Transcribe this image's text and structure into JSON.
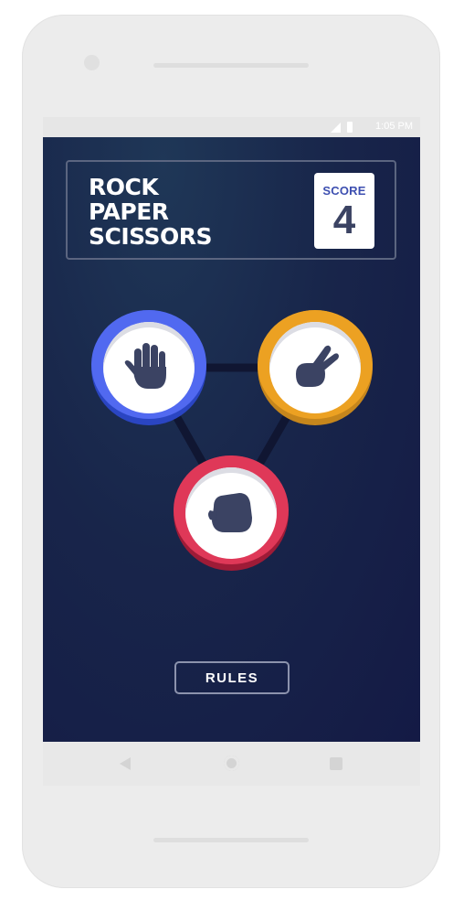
{
  "status_bar": {
    "time": "1:05 PM"
  },
  "header": {
    "title_lines": [
      "ROCK",
      "PAPER",
      "SCISSORS"
    ],
    "score_label": "SCORE",
    "score_value": "4"
  },
  "choices": [
    {
      "name": "paper",
      "icon": "hand-open-icon",
      "color": "#5169f0"
    },
    {
      "name": "scissors",
      "icon": "hand-scissors-icon",
      "color": "#eca122"
    },
    {
      "name": "rock",
      "icon": "hand-fist-icon",
      "color": "#df3858"
    }
  ],
  "rules_button": {
    "label": "RULES"
  },
  "nav_bar": {
    "icons": [
      "back-icon",
      "home-icon",
      "recents-icon"
    ]
  }
}
